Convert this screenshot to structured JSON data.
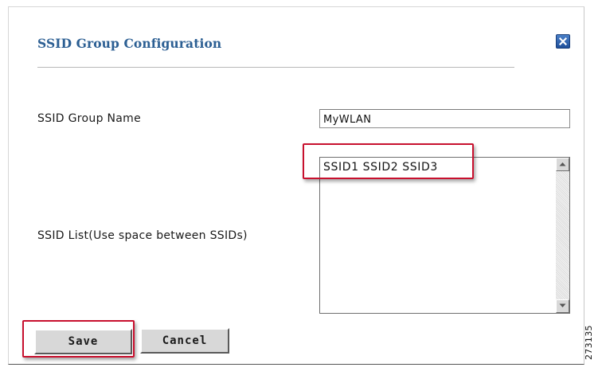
{
  "dialog": {
    "title": "SSID Group Configuration",
    "close_icon": "close-icon"
  },
  "form": {
    "group_name": {
      "label": "SSID Group Name",
      "value": "MyWLAN"
    },
    "ssid_list": {
      "label": "SSID List(Use space between SSIDs)",
      "value": "SSID1 SSID2 SSID3"
    }
  },
  "buttons": {
    "save_label": "Save",
    "cancel_label": "Cancel"
  },
  "annotation": {
    "highlight_color": "#c8102e",
    "figure_number": "273135"
  },
  "colors": {
    "title": "#2c5f93",
    "close_button": "#2a5aa8"
  }
}
